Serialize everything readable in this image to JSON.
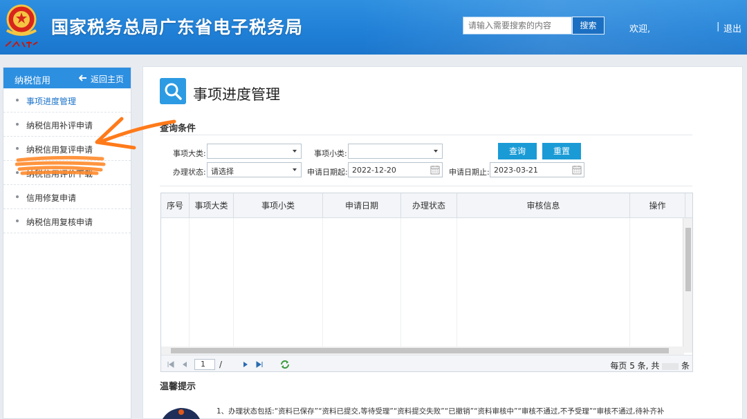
{
  "header": {
    "site_title": "国家税务总局广东省电子税务局",
    "search_placeholder": "请输入需要搜索的内容",
    "search_button": "搜索",
    "welcome": "欢迎,",
    "separator": "|",
    "logout": "退出"
  },
  "sidebar": {
    "title": "纳税信用",
    "back_label": "返回主页",
    "items": [
      {
        "label": "事项进度管理",
        "active": true
      },
      {
        "label": "纳税信用补评申请",
        "active": false
      },
      {
        "label": "纳税信用复评申请",
        "active": false
      },
      {
        "label": "纳税信用评价下载",
        "active": false
      },
      {
        "label": "信用修复申请",
        "active": false
      },
      {
        "label": "纳税信用复核申请",
        "active": false
      }
    ]
  },
  "main": {
    "page_title": "事项进度管理",
    "query_section": "查询条件",
    "filters": {
      "category_label": "事项大类:",
      "category_value": "",
      "subcategory_label": "事项小类:",
      "subcategory_value": "",
      "status_label": "办理状态:",
      "status_value": "请选择",
      "date_start_label": "申请日期起:",
      "date_start_value": "2022-12-20",
      "date_end_label": "申请日期止:",
      "date_end_value": "2023-03-21"
    },
    "buttons": {
      "query": "查询",
      "reset": "重置"
    },
    "table": {
      "columns": [
        "序号",
        "事项大类",
        "事项小类",
        "申请日期",
        "办理状态",
        "审核信息",
        "操作"
      ]
    },
    "pager": {
      "current_page": "1",
      "slash": "/",
      "info": "每页 5 条, 共",
      "info_suffix": "条"
    },
    "tips_title": "温馨提示",
    "tip_line": "1、办理状态包括:“资料已保存”“资料已提交,等待受理”“资料提交失败”“已撤销”“资料审核中”“审核不通过,不予受理”“审核不通过,待补齐补"
  },
  "colors": {
    "header_blue": "#1f7fd6",
    "sidebar_head": "#2d8fe0",
    "button_blue": "#1a9bd6",
    "annotation_orange": "#ff7a1a"
  }
}
